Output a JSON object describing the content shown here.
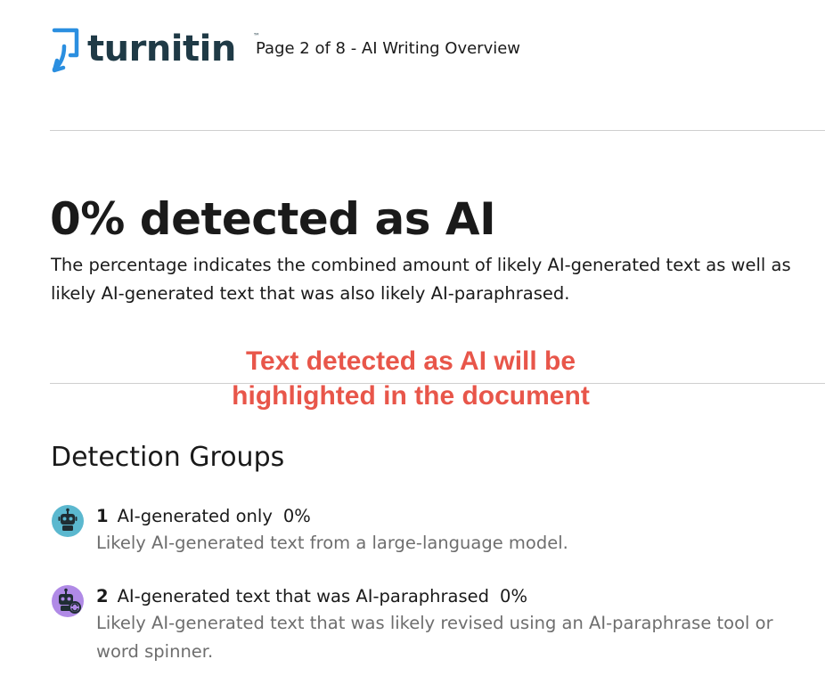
{
  "header": {
    "brand": "turnitin",
    "page_info": "Page 2 of 8 - AI Writing Overview"
  },
  "summary": {
    "headline": "0% detected as AI",
    "description": "The percentage indicates the combined amount of likely AI-generated text as well as likely AI-generated text that was also likely AI-paraphrased."
  },
  "notice": {
    "line1": "Text detected as AI will be",
    "line2": "highlighted in the document"
  },
  "detection_groups": {
    "title": "Detection Groups",
    "items": [
      {
        "number": "1",
        "label": "AI-generated only",
        "percent": "0%",
        "description": "Likely AI-generated text from a large-language model.",
        "icon": "robot-icon",
        "color": "#5bb8cf"
      },
      {
        "number": "2",
        "label": "AI-generated text that was AI-paraphrased",
        "percent": "0%",
        "description": "Likely AI-generated text that was likely revised using an AI-paraphrase tool or word spinner.",
        "icon": "robot-paraphrase-icon",
        "color": "#b08ae6"
      }
    ]
  },
  "colors": {
    "brand_text": "#1f3a46",
    "logo_blue": "#2b8fe0",
    "notice": "#e8564a",
    "rule": "#cfcfcf",
    "muted_text": "#6e6e6e"
  }
}
